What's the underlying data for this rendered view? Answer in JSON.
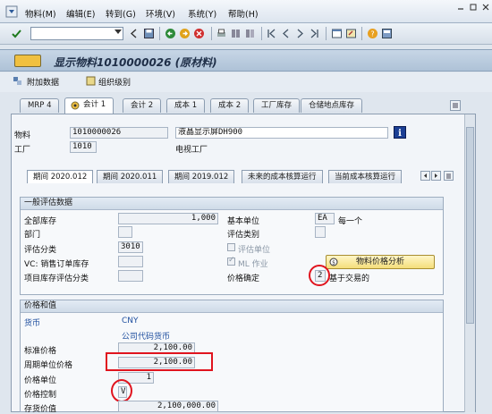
{
  "menubar": {
    "items": [
      "物料(M)",
      "编辑(E)",
      "转到(G)",
      "环境(V)",
      "系统(Y)",
      "帮助(H)"
    ]
  },
  "toolbar": {
    "command_value": ""
  },
  "title": {
    "text": "显示物料1010000026 (原材料)"
  },
  "app_toolbar": {
    "additional_data": "附加数据",
    "org_levels": "组织级别"
  },
  "tabs": [
    "MRP 4",
    "会计 1",
    "会计 2",
    "成本 1",
    "成本 2",
    "工厂库存",
    "仓储地点库存"
  ],
  "header": {
    "material_label": "物料",
    "material_value": "1010000026",
    "material_desc": "液晶显示屏DH900",
    "plant_label": "工厂",
    "plant_value": "1010",
    "plant_desc": "电视工厂"
  },
  "subtabs": [
    "期间 2020.012",
    "期间 2020.011",
    "期间 2019.012",
    "未来的成本核算运行",
    "当前成本核算运行"
  ],
  "general": {
    "heading": "一般评估数据",
    "total_stock_label": "全部库存",
    "total_stock_value": "1,000",
    "base_unit_label": "基本单位",
    "base_unit_value": "EA",
    "base_unit_desc": "每一个",
    "division_label": "部门",
    "division_value": "",
    "val_cat_label": "评估类别",
    "val_cat_value": "",
    "val_class_label": "评估分类",
    "val_class_value": "3010",
    "val_unit_label": "评估单位",
    "vc_label": "VC: 销售订单库存",
    "vc_value": "",
    "ml_label": "ML 作业",
    "proj_label": "项目库存评估分类",
    "proj_value": "",
    "price_analysis_button": "物料价格分析",
    "price_det_label": "价格确定",
    "price_det_value": "2",
    "price_det_desc": "基于交易的"
  },
  "prices": {
    "heading": "价格和值",
    "currency_label": "货币",
    "currency_value": "CNY",
    "company_code_currency": "公司代码货币",
    "std_price_label": "标准价格",
    "std_price_value": "2,100.00",
    "periodic_price_label": "周期单位价格",
    "periodic_price_value": "2,100.00",
    "price_unit_label": "价格单位",
    "price_unit_value": "1",
    "price_control_label": "价格控制",
    "price_control_value": "V",
    "inventory_value_label": "存货价值",
    "inventory_value_value": "2,100,000.00"
  }
}
